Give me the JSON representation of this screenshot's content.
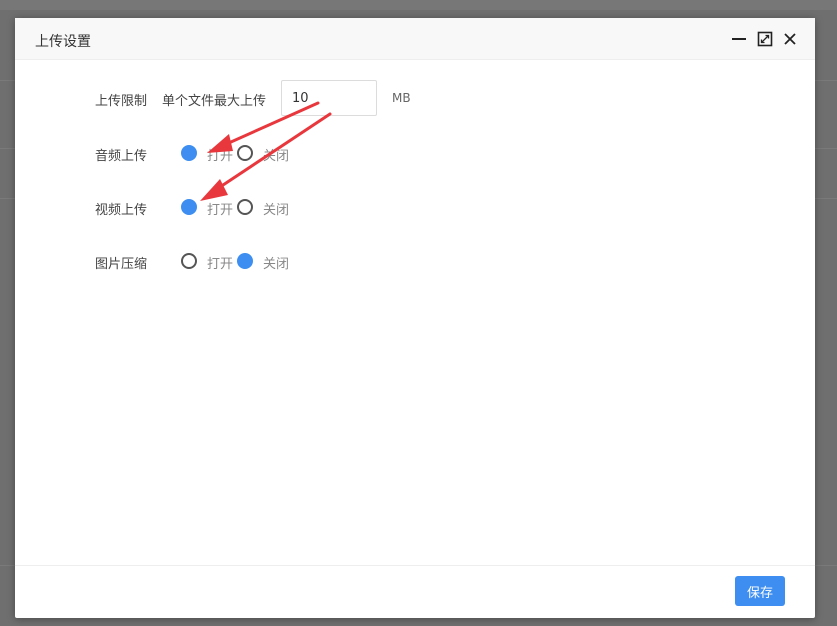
{
  "dialog": {
    "title": "上传设置",
    "header_icons": [
      "minimize-icon",
      "maximize-icon",
      "close-icon"
    ]
  },
  "form": {
    "limit": {
      "label": "上传限制",
      "sub_label": "单个文件最大上传",
      "value": "10",
      "unit": "MB"
    },
    "audio": {
      "label": "音频上传",
      "on_label": "打开",
      "off_label": "关闭",
      "selected": "打开"
    },
    "video": {
      "label": "视频上传",
      "on_label": "打开",
      "off_label": "关闭",
      "selected": "打开"
    },
    "image": {
      "label": "图片压缩",
      "on_label": "打开",
      "off_label": "关闭",
      "selected": "关闭"
    }
  },
  "footer": {
    "save_label": "保存"
  },
  "colors": {
    "accent": "#3d8ef0",
    "annotation_arrow": "#e8383d",
    "backdrop": "#6f6f6f"
  }
}
